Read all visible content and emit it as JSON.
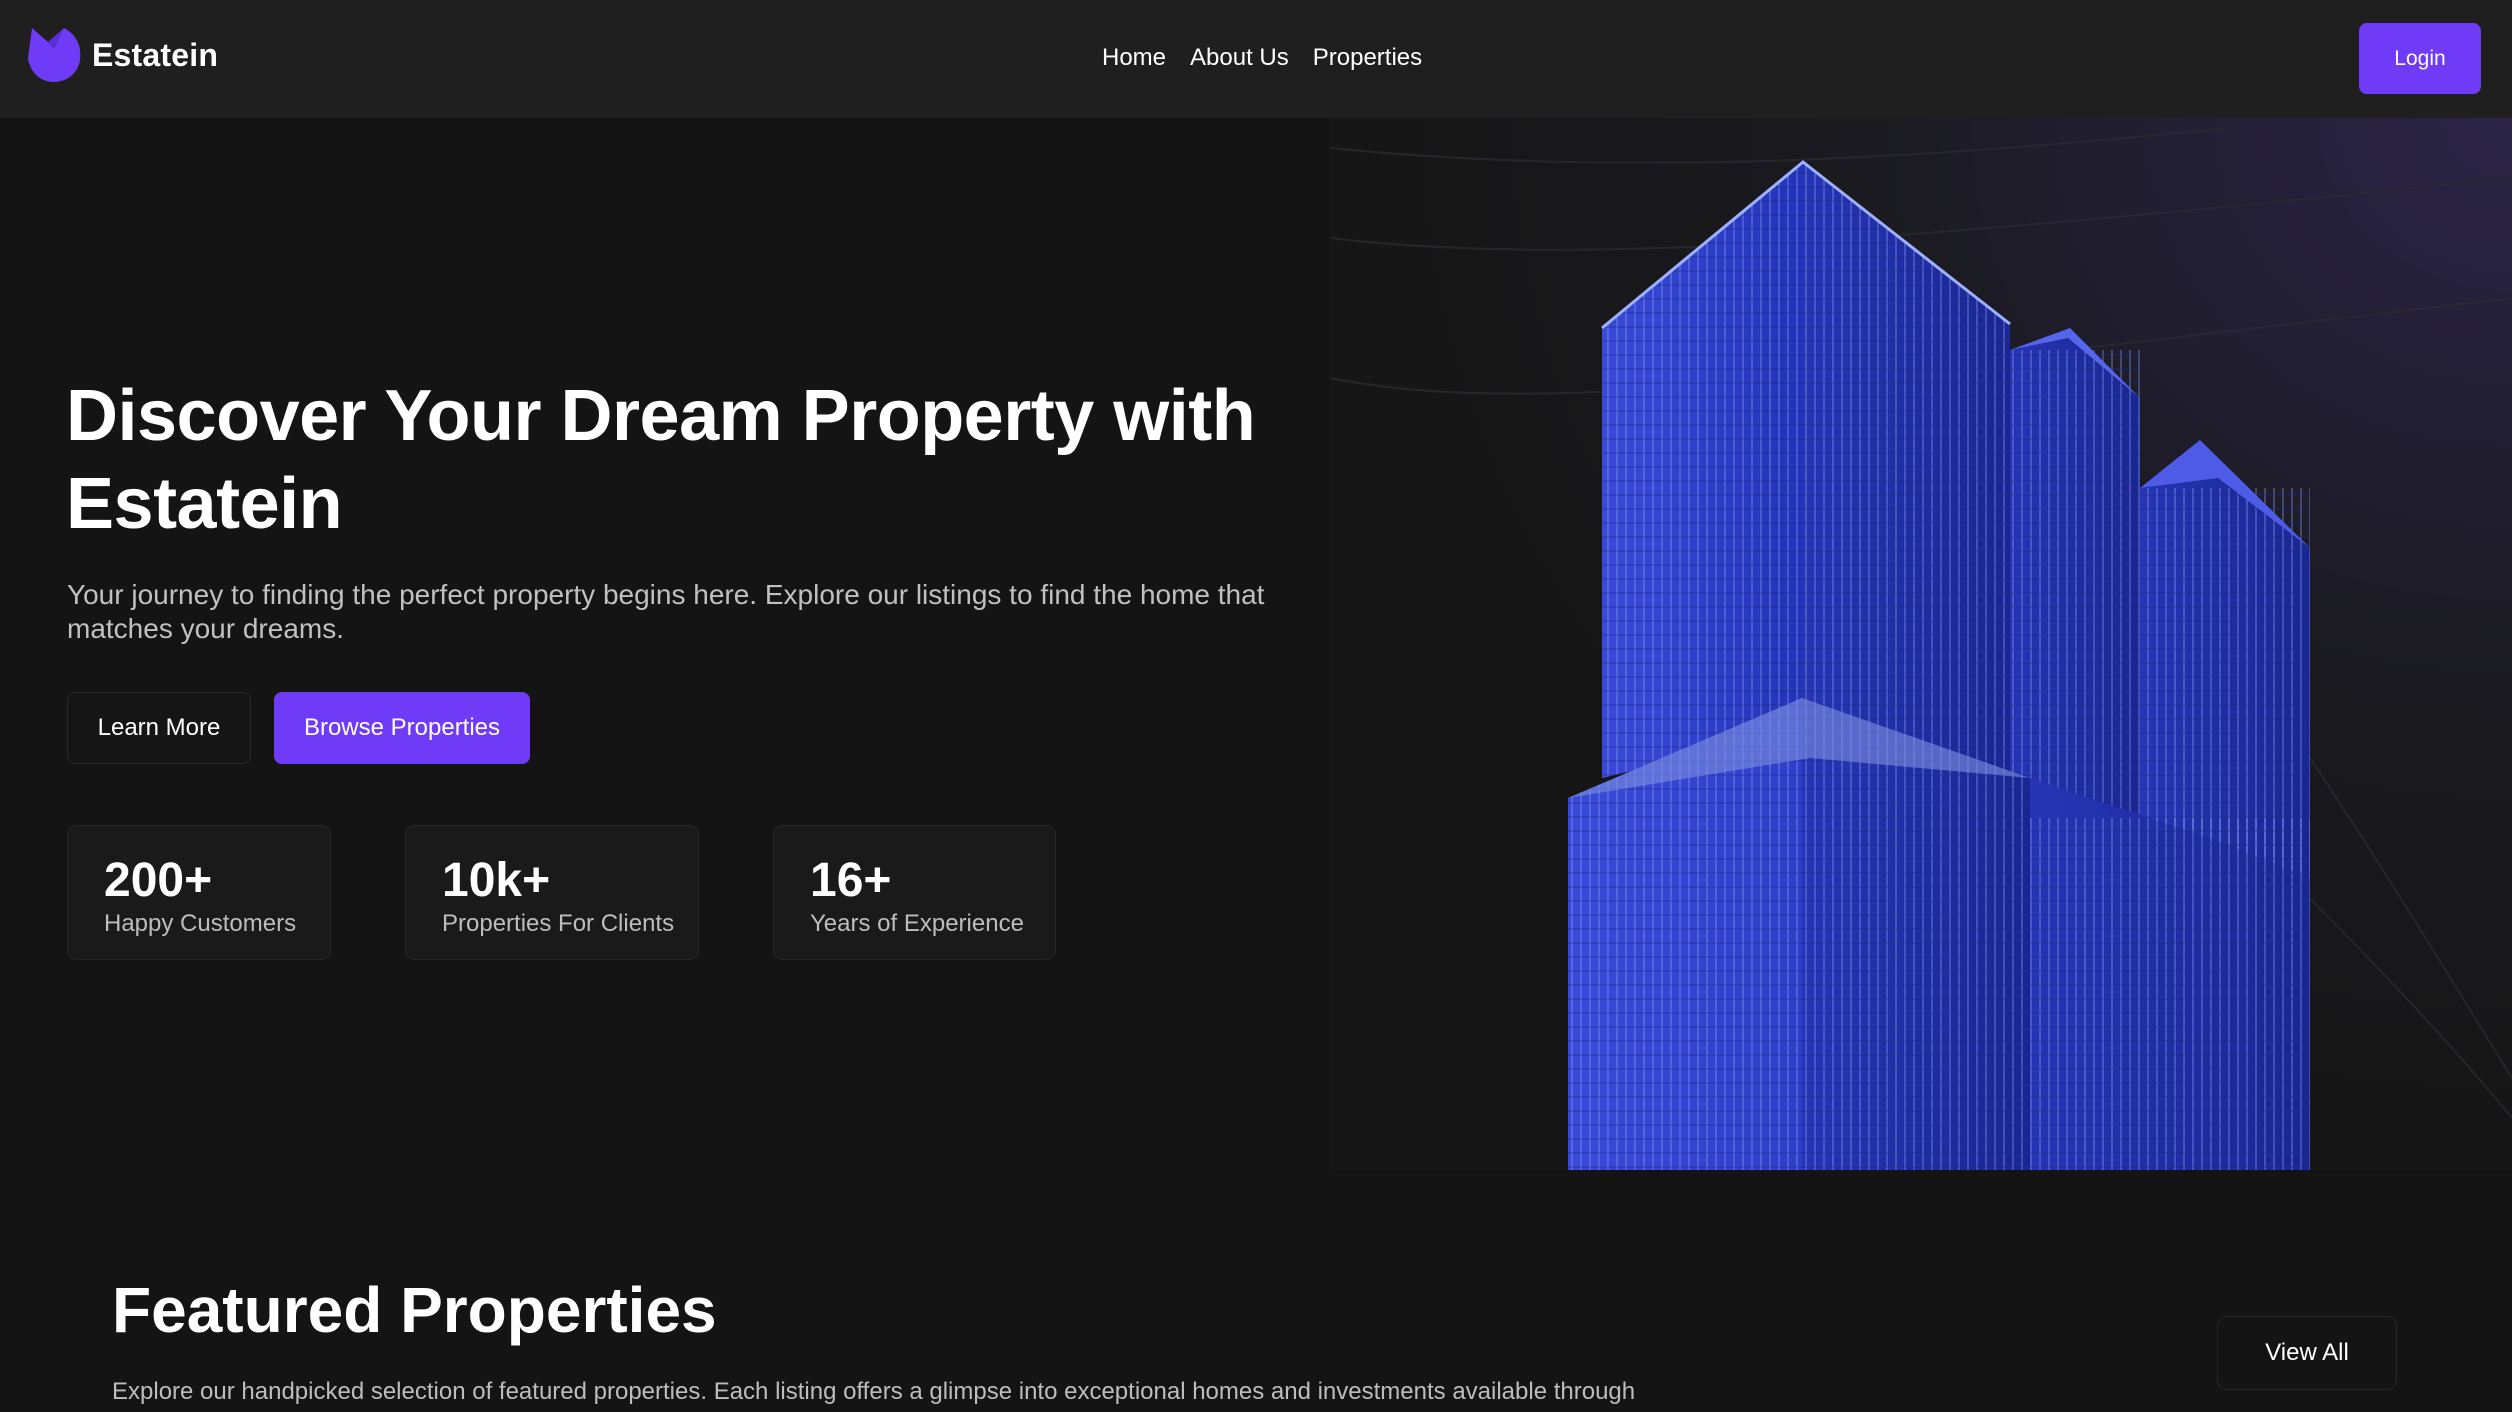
{
  "brand": {
    "name": "Estatein",
    "accent_color": "#703BF7"
  },
  "nav": {
    "items": [
      "Home",
      "About Us",
      "Properties"
    ]
  },
  "header": {
    "login_label": "Login"
  },
  "hero": {
    "title": "Discover Your Dream Property with Estatein",
    "description": "Your journey to finding the perfect property begins here. Explore our listings to find the home that matches your dreams.",
    "learn_more_label": "Learn More",
    "browse_label": "Browse Properties",
    "stats": [
      {
        "value": "200+",
        "label": "Happy Customers"
      },
      {
        "value": "10k+",
        "label": "Properties For Clients"
      },
      {
        "value": "16+",
        "label": "Years of Experience"
      }
    ]
  },
  "featured": {
    "title": "Featured Properties",
    "description": "Explore our handpicked selection of featured properties. Each listing offers a glimpse into exceptional homes and investments available through",
    "view_all_label": "View All"
  },
  "icons": {
    "logo": "estatein-logo-icon"
  }
}
